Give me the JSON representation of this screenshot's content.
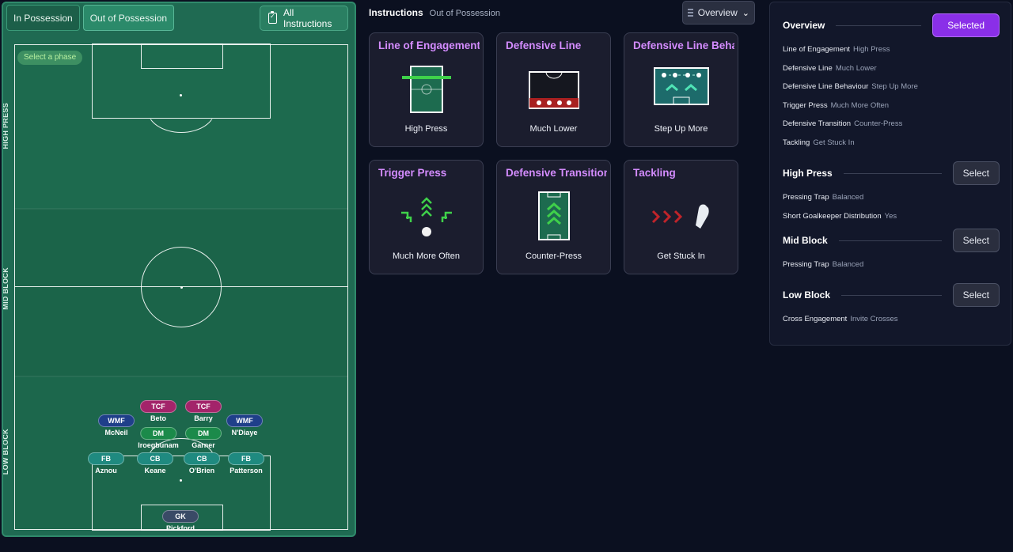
{
  "pitch": {
    "tabs": [
      {
        "label": "In Possession",
        "active": false
      },
      {
        "label": "Out of Possession",
        "active": true
      }
    ],
    "all_instructions_label": "All Instructions",
    "phase_pill": "Select a phase",
    "zone_labels": {
      "high": "HIGH PRESS",
      "mid": "MID BLOCK",
      "low": "LOW BLOCK"
    },
    "players": [
      {
        "pos": "TCF",
        "name": "Beto",
        "type": "att"
      },
      {
        "pos": "TCF",
        "name": "Barry",
        "type": "att"
      },
      {
        "pos": "WMF",
        "name": "McNeil",
        "type": "wide"
      },
      {
        "pos": "WMF",
        "name": "N'Diaye",
        "type": "wide"
      },
      {
        "pos": "DM",
        "name": "Iroegbunam",
        "type": "mid"
      },
      {
        "pos": "DM",
        "name": "Garner",
        "type": "mid"
      },
      {
        "pos": "FB",
        "name": "Aznou",
        "type": "def"
      },
      {
        "pos": "CB",
        "name": "Keane",
        "type": "def"
      },
      {
        "pos": "CB",
        "name": "O'Brien",
        "type": "def"
      },
      {
        "pos": "FB",
        "name": "Patterson",
        "type": "def"
      },
      {
        "pos": "GK",
        "name": "Pickford",
        "type": "gk"
      }
    ]
  },
  "instructions": {
    "title": "Instructions",
    "subtitle": "Out of Possession",
    "view_dropdown": "Overview",
    "cards": [
      {
        "title": "Line of Engagement",
        "value": "High Press",
        "art": "line-engagement"
      },
      {
        "title": "Defensive Line",
        "value": "Much Lower",
        "art": "defensive-line"
      },
      {
        "title": "Defensive Line Behaviour",
        "value": "Step Up More",
        "art": "line-behaviour"
      },
      {
        "title": "Trigger Press",
        "value": "Much More Often",
        "art": "trigger-press"
      },
      {
        "title": "Defensive Transition",
        "value": "Counter-Press",
        "art": "transition"
      },
      {
        "title": "Tackling",
        "value": "Get Stuck In",
        "art": "tackling"
      }
    ]
  },
  "overview": {
    "sections": [
      {
        "title": "Overview",
        "button": "Selected",
        "selected": true,
        "rows": [
          {
            "k": "Line of Engagement",
            "v": "High Press"
          },
          {
            "k": "Defensive Line",
            "v": "Much Lower"
          },
          {
            "k": "Defensive Line Behaviour",
            "v": "Step Up More"
          },
          {
            "k": "Trigger Press",
            "v": "Much More Often"
          },
          {
            "k": "Defensive Transition",
            "v": "Counter-Press"
          },
          {
            "k": "Tackling",
            "v": "Get Stuck In"
          }
        ]
      },
      {
        "title": "High Press",
        "button": "Select",
        "selected": false,
        "rows": [
          {
            "k": "Pressing Trap",
            "v": "Balanced"
          },
          {
            "k": "Short Goalkeeper Distribution",
            "v": "Yes"
          }
        ]
      },
      {
        "title": "Mid Block",
        "button": "Select",
        "selected": false,
        "rows": [
          {
            "k": "Pressing Trap",
            "v": "Balanced"
          }
        ]
      },
      {
        "title": "Low Block",
        "button": "Select",
        "selected": false,
        "rows": [
          {
            "k": "Cross Engagement",
            "v": "Invite Crosses"
          }
        ]
      }
    ]
  },
  "colors": {
    "accent_purple": "#8a2fe8",
    "card_title": "#d48cff",
    "pitch_green": "#1d6b4f"
  }
}
